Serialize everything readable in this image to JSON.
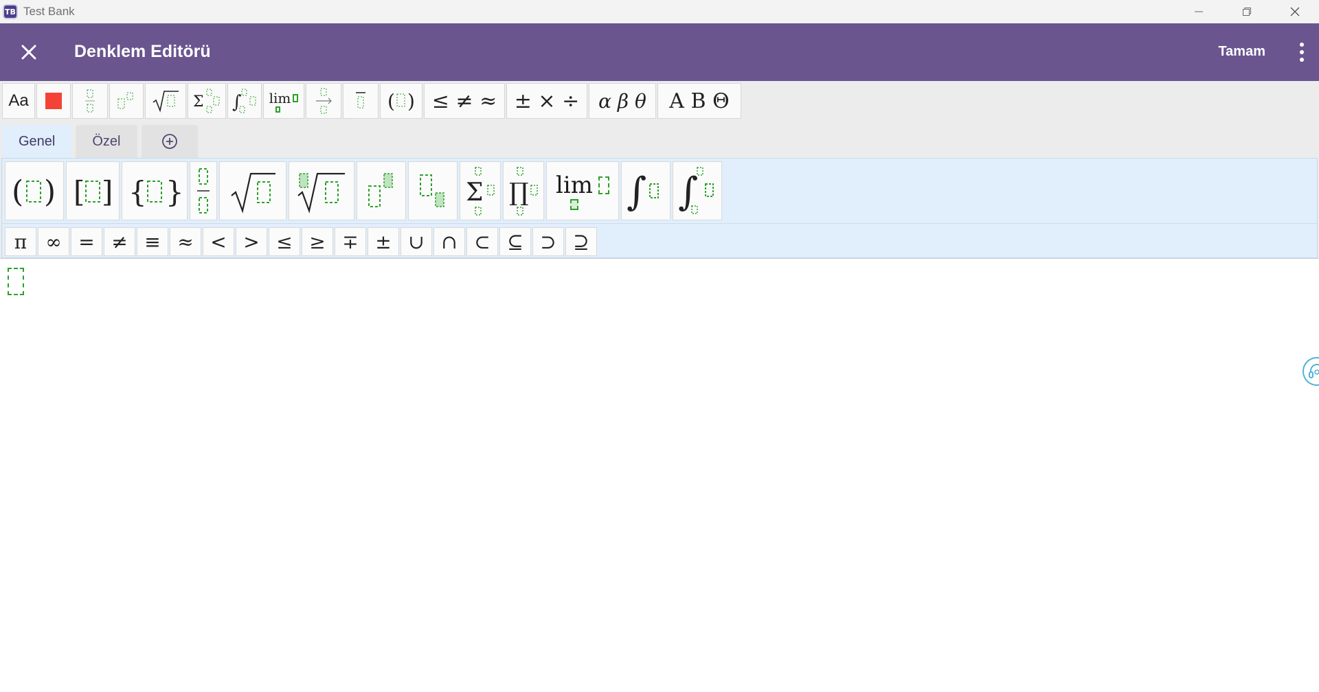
{
  "window": {
    "app_icon_text": "TB",
    "title": "Test Bank",
    "controls": [
      "minimize-icon",
      "restore-icon",
      "close-icon"
    ]
  },
  "appbar": {
    "title": "Denklem Editörü",
    "done_label": "Tamam",
    "close_icon": "close-icon",
    "more_icon": "more-vertical-icon",
    "background_color": "#6a558f"
  },
  "quickbar": {
    "font_label": "Aa",
    "color_swatch": "#f44336",
    "lim_label": "lim",
    "relations": "≤ ≠ ≈",
    "operators": "± × ÷",
    "greek_lower": "α β θ",
    "greek_upper": "A B Θ"
  },
  "tabs": [
    {
      "label": "Genel",
      "active": true
    },
    {
      "label": "Özel",
      "active": false
    },
    {
      "label": "⊕",
      "active": false
    }
  ],
  "templates": {
    "lim_label": "lim"
  },
  "symbols": [
    "π",
    "∞",
    "=",
    "≠",
    "≡",
    "≈",
    "<",
    ">",
    "≤",
    "≥",
    "∓",
    "±",
    "∪",
    "∩",
    "⊂",
    "⊆",
    "⊃",
    "⊇"
  ],
  "colors": {
    "placeholder": "#2ca02c",
    "panel": "#e1eefb",
    "assistant_ring": "#4fb3d9"
  }
}
